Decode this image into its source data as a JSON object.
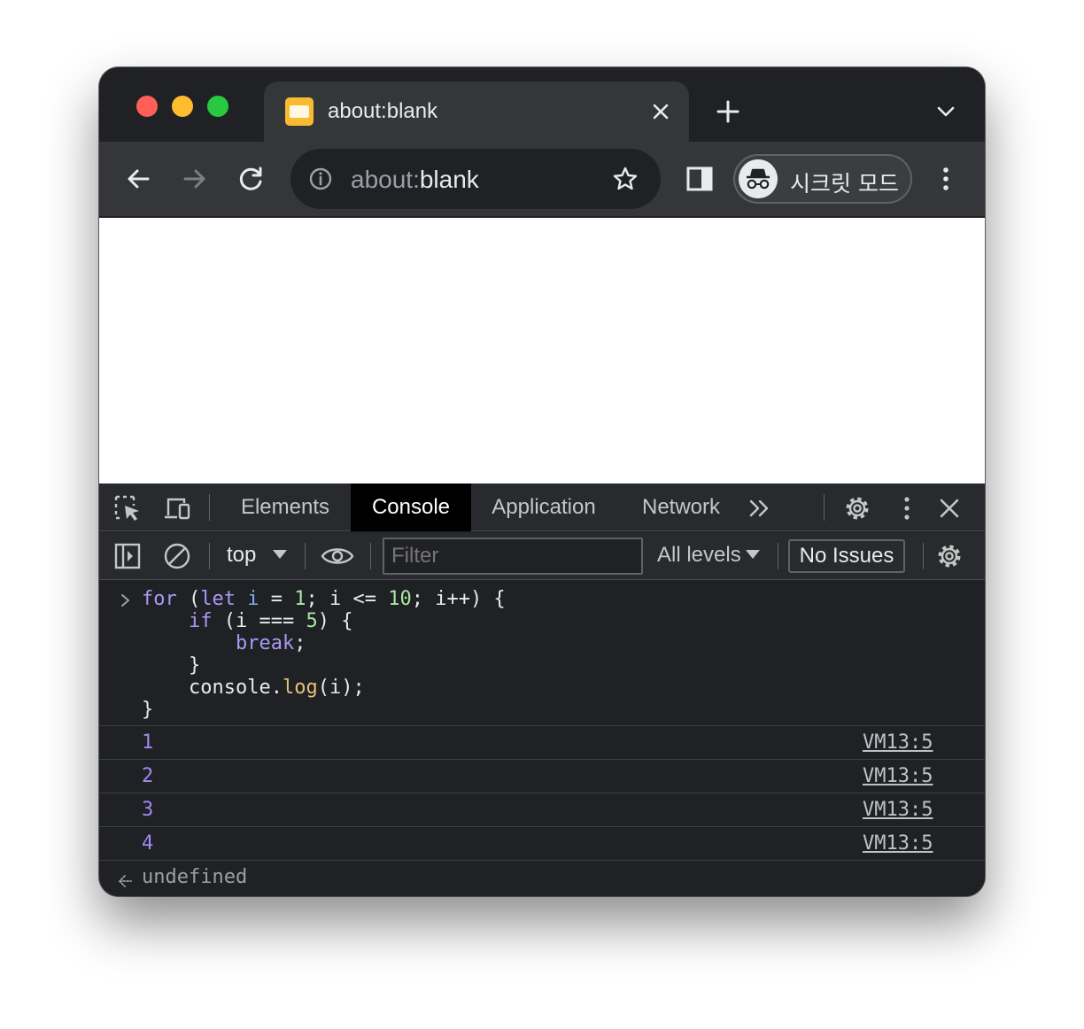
{
  "tab": {
    "title": "about:blank",
    "close_label": "close tab"
  },
  "toolbar": {
    "url_scheme": "about:",
    "url_path": "blank",
    "incognito_label": "시크릿 모드"
  },
  "devtools": {
    "tabs": [
      {
        "label": "Elements",
        "active": false
      },
      {
        "label": "Console",
        "active": true
      },
      {
        "label": "Application",
        "active": false
      },
      {
        "label": "Network",
        "active": false
      }
    ],
    "context": "top",
    "filter_placeholder": "Filter",
    "levels_label": "All levels",
    "issues_label": "No Issues"
  },
  "console": {
    "code_lines": [
      "for (let i = 1; i <= 10; i++) {",
      "    if (i === 5) {",
      "        break;",
      "    }",
      "    console.log(i);",
      "}"
    ],
    "logs": [
      {
        "value": "1",
        "source": "VM13:5"
      },
      {
        "value": "2",
        "source": "VM13:5"
      },
      {
        "value": "3",
        "source": "VM13:5"
      },
      {
        "value": "4",
        "source": "VM13:5"
      }
    ],
    "result": "undefined"
  },
  "colors": {
    "traffic_red": "#ff5f57",
    "traffic_yellow": "#febc2e",
    "traffic_green": "#28c840",
    "log_number": "#9d8cf4",
    "keyword": "#c792ea",
    "number_literal": "#a8e6a1"
  }
}
